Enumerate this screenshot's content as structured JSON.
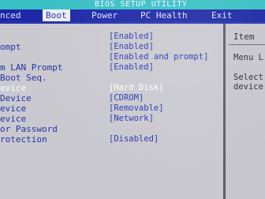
{
  "window": {
    "title": "BIOS SETUP UTILITY"
  },
  "menu": {
    "items": [
      {
        "label": "nced"
      },
      {
        "label": "Boot"
      },
      {
        "label": "Power"
      },
      {
        "label": "PC Health"
      },
      {
        "label": "Exit"
      }
    ],
    "active": "Boot"
  },
  "settings": {
    "rows": [
      {
        "label": "",
        "value": "[Enabled]"
      },
      {
        "label": "ompt",
        "value": "[Enabled]"
      },
      {
        "label": "",
        "value": "[Enabled and prompt]"
      },
      {
        "label": "m LAN Prompt",
        "value": "[Enabled]"
      },
      {
        "label": " Boot Seq.",
        "value": ""
      },
      {
        "label": "evice",
        "value": "[Hard Disk]",
        "selected": true
      },
      {
        "label": "Device",
        "value": "[CDROM]"
      },
      {
        "label": "evice",
        "value": "[Removable]"
      },
      {
        "label": "evice",
        "value": "[Network]"
      },
      {
        "label": "or Password",
        "value": ""
      },
      {
        "label": "rotection",
        "value": "[Disabled]"
      }
    ]
  },
  "help_panel": {
    "heading": "Item",
    "line1": "Menu L",
    "line2": "Select",
    "line3": "device"
  },
  "colors": {
    "title_bar": "#39c0c4",
    "menu_bar": "#1d28a6",
    "panel": "#c9c9cf",
    "label_text": "#2632a6",
    "selected_text": "#ffffff"
  }
}
